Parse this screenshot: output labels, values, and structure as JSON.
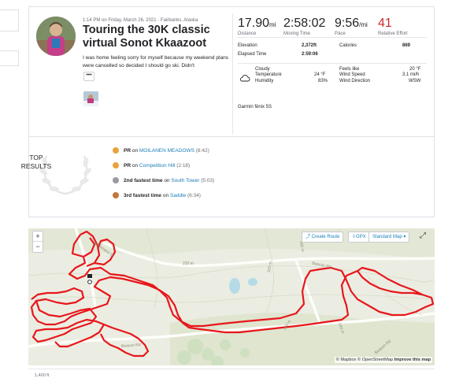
{
  "activity": {
    "meta": "1:14 PM on Friday, March 26, 2021 · Fairbanks, Alaska",
    "title": "Touring the 30K classic virtual Sonot Kkaazoot",
    "description": "I was home feeling sorry for myself because my weekend plans were cancelled so decided I should go ski. Didn't",
    "more_label": "•••"
  },
  "stats": {
    "distance_value": "17.90",
    "distance_unit": "mi",
    "distance_label": "Distance",
    "moving_time_value": "2:58:02",
    "moving_time_label": "Moving Time",
    "pace_value": "9:56",
    "pace_unit": "/mi",
    "pace_label": "Pace",
    "effort_value": "41",
    "effort_label": "Relative Effort",
    "effort_color": "#cc2b2b"
  },
  "details": {
    "elevation_label": "Elevation",
    "elevation_value": "2,372ft",
    "elapsed_label": "Elapsed Time",
    "elapsed_value": "2:59:06",
    "calories_label": "Calories",
    "calories_value": "869"
  },
  "weather": {
    "condition": "Cloudy",
    "temperature_label": "Temperature",
    "temperature_value": "24 °F",
    "humidity_label": "Humidity",
    "humidity_value": "83%",
    "feels_like_label": "Feels like",
    "feels_like_value": "20 °F",
    "wind_speed_label": "Wind Speed",
    "wind_speed_value": "3.1 mi/h",
    "wind_direction_label": "Wind Direction",
    "wind_direction_value": "WSW",
    "icon": "cloud-icon"
  },
  "device": "Garmin fēnix 5S",
  "top_results": {
    "label_line1": "TOP",
    "label_line2": "RESULTS",
    "items": [
      {
        "prefix": "PR",
        "on": "on",
        "segment": "MOILANEN MEADOWS",
        "time": "(8:42)",
        "medal": "pr-medal-icon",
        "color": "#e8a33d"
      },
      {
        "prefix": "PR",
        "on": "on",
        "segment": "Competition Hill",
        "time": "(2:18)",
        "medal": "pr-medal-icon",
        "color": "#e8a33d"
      },
      {
        "prefix": "2nd fastest time",
        "on": "on",
        "segment": "South Tower",
        "time": "(5:03)",
        "medal": "silver-medal-icon",
        "color": "#9a9aa2"
      },
      {
        "prefix": "3rd fastest time",
        "on": "on",
        "segment": "Saddle",
        "time": "(6:34)",
        "medal": "bronze-medal-icon",
        "color": "#c0783a"
      }
    ]
  },
  "map": {
    "zoom_in": "+",
    "zoom_out": "−",
    "create_route": "Create Route",
    "gpx": "GPX",
    "map_type": "Standard Map",
    "fullscreen_icon": "fullscreen-icon",
    "credit_mapbox": "© Mapbox",
    "credit_osm": "© OpenStreetMap",
    "credit_improve": "Improve this map",
    "labels": {
      "wilderness": "Wilderness Dr",
      "beacon_rd_1": "Beacon Rd",
      "beacon_rd_2": "Beacon Rd",
      "beacon_rd_3": "Beacon Rd",
      "c220a": "220 m",
      "c220b": "220 m",
      "c240a": "240 m",
      "c240b": "240 m",
      "c260": "260 m"
    },
    "route_color": "#e8161b"
  },
  "elevation_axis": "1,400 ft"
}
